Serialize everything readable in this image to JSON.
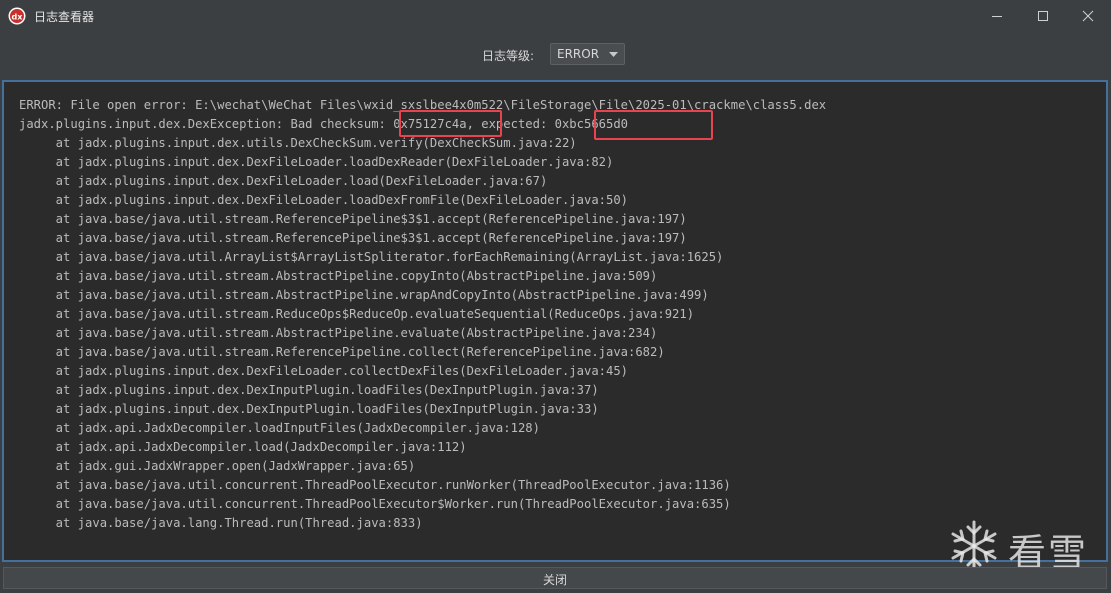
{
  "window": {
    "title": "日志查看器",
    "app_icon": "jadx-icon"
  },
  "toolbar": {
    "level_label": "日志等级:",
    "level_selected": "ERROR"
  },
  "log": {
    "lines": [
      "ERROR: File open error: E:\\wechat\\WeChat Files\\wxid_sxslbee4x0m522\\FileStorage\\File\\2025-01\\crackme\\class5.dex",
      "jadx.plugins.input.dex.DexException: Bad checksum: 0x75127c4a, expected: 0xbc5665d0",
      "\tat jadx.plugins.input.dex.utils.DexCheckSum.verify(DexCheckSum.java:22)",
      "\tat jadx.plugins.input.dex.DexFileLoader.loadDexReader(DexFileLoader.java:82)",
      "\tat jadx.plugins.input.dex.DexFileLoader.load(DexFileLoader.java:67)",
      "\tat jadx.plugins.input.dex.DexFileLoader.loadDexFromFile(DexFileLoader.java:50)",
      "\tat java.base/java.util.stream.ReferencePipeline$3$1.accept(ReferencePipeline.java:197)",
      "\tat java.base/java.util.stream.ReferencePipeline$3$1.accept(ReferencePipeline.java:197)",
      "\tat java.base/java.util.ArrayList$ArrayListSpliterator.forEachRemaining(ArrayList.java:1625)",
      "\tat java.base/java.util.stream.AbstractPipeline.copyInto(AbstractPipeline.java:509)",
      "\tat java.base/java.util.stream.AbstractPipeline.wrapAndCopyInto(AbstractPipeline.java:499)",
      "\tat java.base/java.util.stream.ReduceOps$ReduceOp.evaluateSequential(ReduceOps.java:921)",
      "\tat java.base/java.util.stream.AbstractPipeline.evaluate(AbstractPipeline.java:234)",
      "\tat java.base/java.util.stream.ReferencePipeline.collect(ReferencePipeline.java:682)",
      "\tat jadx.plugins.input.dex.DexFileLoader.collectDexFiles(DexFileLoader.java:45)",
      "\tat jadx.plugins.input.dex.DexInputPlugin.loadFiles(DexInputPlugin.java:37)",
      "\tat jadx.plugins.input.dex.DexInputPlugin.loadFiles(DexInputPlugin.java:33)",
      "\tat jadx.api.JadxDecompiler.loadInputFiles(JadxDecompiler.java:128)",
      "\tat jadx.api.JadxDecompiler.load(JadxDecompiler.java:112)",
      "\tat jadx.gui.JadxWrapper.open(JadxWrapper.java:65)",
      "\tat java.base/java.util.concurrent.ThreadPoolExecutor.runWorker(ThreadPoolExecutor.java:1136)",
      "\tat java.base/java.util.concurrent.ThreadPoolExecutor$Worker.run(ThreadPoolExecutor.java:635)",
      "\tat java.base/java.lang.Thread.run(Thread.java:833)"
    ]
  },
  "watermark": {
    "text": "看雪",
    "icon": "snowflake-icon"
  },
  "footer": {
    "close_label": "关闭"
  },
  "colors": {
    "background": "#3c3f41",
    "log_background": "#2b2b2b",
    "log_border": "#46709c",
    "highlight": "#e8434f",
    "text": "#bbbbbb"
  }
}
